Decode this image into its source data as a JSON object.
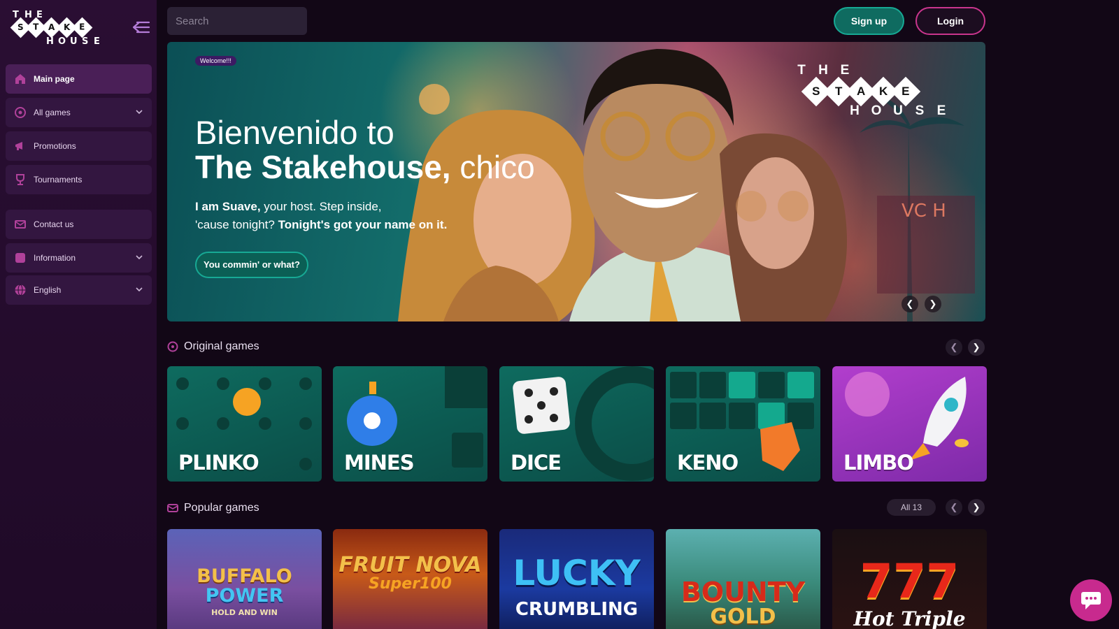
{
  "logo": {
    "top": [
      "T",
      "H",
      "E"
    ],
    "middle": [
      "S",
      "T",
      "A",
      "K",
      "E"
    ],
    "bottom": [
      "H",
      "O",
      "U",
      "S",
      "E"
    ]
  },
  "sidebar": {
    "items": [
      {
        "label": "Main page",
        "icon": "home-icon"
      },
      {
        "label": "All games",
        "icon": "games-icon"
      },
      {
        "label": "Promotions",
        "icon": "megaphone-icon"
      },
      {
        "label": "Tournaments",
        "icon": "trophy-icon"
      },
      {
        "label": "Contact us",
        "icon": "mail-icon"
      },
      {
        "label": "Information",
        "icon": "info-icon"
      },
      {
        "label": "English",
        "icon": "globe-icon"
      }
    ]
  },
  "header": {
    "search_placeholder": "Search",
    "signup_label": "Sign up",
    "login_label": "Login"
  },
  "hero": {
    "badge": "Welcome!!!",
    "title_line1": "Bienvenido to",
    "title_bold": "The Stakehouse,",
    "title_light": "chico",
    "text_bold1": "I am Suave,",
    "text_1": "your host. Step inside,",
    "text_2": "'cause tonight?",
    "text_bold2": "Tonight's got your name on it.",
    "cta": "You commin' or what?",
    "logo_top": [
      "T",
      "H",
      "E"
    ],
    "logo_middle": [
      "S",
      "T",
      "A",
      "K",
      "E"
    ],
    "logo_bottom": [
      "H",
      "O",
      "U",
      "S",
      "E"
    ]
  },
  "original_games": {
    "title": "Original games",
    "games": [
      "PLINKO",
      "MINES",
      "DICE",
      "KENO",
      "LIMBO"
    ]
  },
  "popular_games": {
    "title": "Popular games",
    "all_label": "All 13",
    "games": [
      {
        "line1": "BUFFALO",
        "line2": "POWER",
        "line3": "HOLD AND WIN"
      },
      {
        "line1": "FRUIT NOVA",
        "line2": "Super100"
      },
      {
        "line1": "LUCKY",
        "line2": "CRUMBLING"
      },
      {
        "line1": "BOUNTY",
        "line2": "GOLD"
      },
      {
        "line1": "777",
        "line2": "Hot Triple"
      }
    ]
  },
  "colors": {
    "accent_teal": "#17a994",
    "accent_pink": "#c9358d",
    "sidebar_bg": "#2a0e33"
  }
}
